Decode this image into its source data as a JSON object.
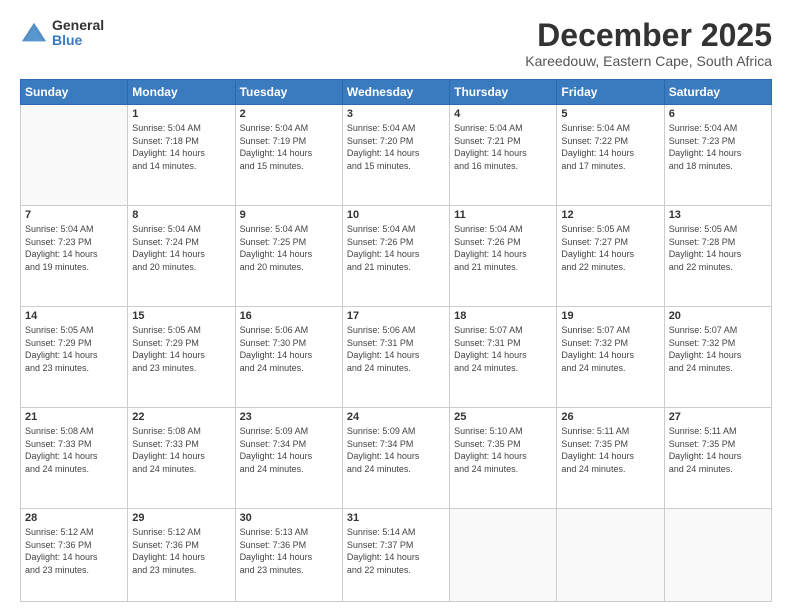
{
  "logo": {
    "general": "General",
    "blue": "Blue"
  },
  "title": "December 2025",
  "location": "Kareedouw, Eastern Cape, South Africa",
  "weekdays": [
    "Sunday",
    "Monday",
    "Tuesday",
    "Wednesday",
    "Thursday",
    "Friday",
    "Saturday"
  ],
  "weeks": [
    [
      {
        "day": "",
        "info": ""
      },
      {
        "day": "1",
        "info": "Sunrise: 5:04 AM\nSunset: 7:18 PM\nDaylight: 14 hours\nand 14 minutes."
      },
      {
        "day": "2",
        "info": "Sunrise: 5:04 AM\nSunset: 7:19 PM\nDaylight: 14 hours\nand 15 minutes."
      },
      {
        "day": "3",
        "info": "Sunrise: 5:04 AM\nSunset: 7:20 PM\nDaylight: 14 hours\nand 15 minutes."
      },
      {
        "day": "4",
        "info": "Sunrise: 5:04 AM\nSunset: 7:21 PM\nDaylight: 14 hours\nand 16 minutes."
      },
      {
        "day": "5",
        "info": "Sunrise: 5:04 AM\nSunset: 7:22 PM\nDaylight: 14 hours\nand 17 minutes."
      },
      {
        "day": "6",
        "info": "Sunrise: 5:04 AM\nSunset: 7:23 PM\nDaylight: 14 hours\nand 18 minutes."
      }
    ],
    [
      {
        "day": "7",
        "info": "Sunrise: 5:04 AM\nSunset: 7:23 PM\nDaylight: 14 hours\nand 19 minutes."
      },
      {
        "day": "8",
        "info": "Sunrise: 5:04 AM\nSunset: 7:24 PM\nDaylight: 14 hours\nand 20 minutes."
      },
      {
        "day": "9",
        "info": "Sunrise: 5:04 AM\nSunset: 7:25 PM\nDaylight: 14 hours\nand 20 minutes."
      },
      {
        "day": "10",
        "info": "Sunrise: 5:04 AM\nSunset: 7:26 PM\nDaylight: 14 hours\nand 21 minutes."
      },
      {
        "day": "11",
        "info": "Sunrise: 5:04 AM\nSunset: 7:26 PM\nDaylight: 14 hours\nand 21 minutes."
      },
      {
        "day": "12",
        "info": "Sunrise: 5:05 AM\nSunset: 7:27 PM\nDaylight: 14 hours\nand 22 minutes."
      },
      {
        "day": "13",
        "info": "Sunrise: 5:05 AM\nSunset: 7:28 PM\nDaylight: 14 hours\nand 22 minutes."
      }
    ],
    [
      {
        "day": "14",
        "info": "Sunrise: 5:05 AM\nSunset: 7:29 PM\nDaylight: 14 hours\nand 23 minutes."
      },
      {
        "day": "15",
        "info": "Sunrise: 5:05 AM\nSunset: 7:29 PM\nDaylight: 14 hours\nand 23 minutes."
      },
      {
        "day": "16",
        "info": "Sunrise: 5:06 AM\nSunset: 7:30 PM\nDaylight: 14 hours\nand 24 minutes."
      },
      {
        "day": "17",
        "info": "Sunrise: 5:06 AM\nSunset: 7:31 PM\nDaylight: 14 hours\nand 24 minutes."
      },
      {
        "day": "18",
        "info": "Sunrise: 5:07 AM\nSunset: 7:31 PM\nDaylight: 14 hours\nand 24 minutes."
      },
      {
        "day": "19",
        "info": "Sunrise: 5:07 AM\nSunset: 7:32 PM\nDaylight: 14 hours\nand 24 minutes."
      },
      {
        "day": "20",
        "info": "Sunrise: 5:07 AM\nSunset: 7:32 PM\nDaylight: 14 hours\nand 24 minutes."
      }
    ],
    [
      {
        "day": "21",
        "info": "Sunrise: 5:08 AM\nSunset: 7:33 PM\nDaylight: 14 hours\nand 24 minutes."
      },
      {
        "day": "22",
        "info": "Sunrise: 5:08 AM\nSunset: 7:33 PM\nDaylight: 14 hours\nand 24 minutes."
      },
      {
        "day": "23",
        "info": "Sunrise: 5:09 AM\nSunset: 7:34 PM\nDaylight: 14 hours\nand 24 minutes."
      },
      {
        "day": "24",
        "info": "Sunrise: 5:09 AM\nSunset: 7:34 PM\nDaylight: 14 hours\nand 24 minutes."
      },
      {
        "day": "25",
        "info": "Sunrise: 5:10 AM\nSunset: 7:35 PM\nDaylight: 14 hours\nand 24 minutes."
      },
      {
        "day": "26",
        "info": "Sunrise: 5:11 AM\nSunset: 7:35 PM\nDaylight: 14 hours\nand 24 minutes."
      },
      {
        "day": "27",
        "info": "Sunrise: 5:11 AM\nSunset: 7:35 PM\nDaylight: 14 hours\nand 24 minutes."
      }
    ],
    [
      {
        "day": "28",
        "info": "Sunrise: 5:12 AM\nSunset: 7:36 PM\nDaylight: 14 hours\nand 23 minutes."
      },
      {
        "day": "29",
        "info": "Sunrise: 5:12 AM\nSunset: 7:36 PM\nDaylight: 14 hours\nand 23 minutes."
      },
      {
        "day": "30",
        "info": "Sunrise: 5:13 AM\nSunset: 7:36 PM\nDaylight: 14 hours\nand 23 minutes."
      },
      {
        "day": "31",
        "info": "Sunrise: 5:14 AM\nSunset: 7:37 PM\nDaylight: 14 hours\nand 22 minutes."
      },
      {
        "day": "",
        "info": ""
      },
      {
        "day": "",
        "info": ""
      },
      {
        "day": "",
        "info": ""
      }
    ]
  ]
}
